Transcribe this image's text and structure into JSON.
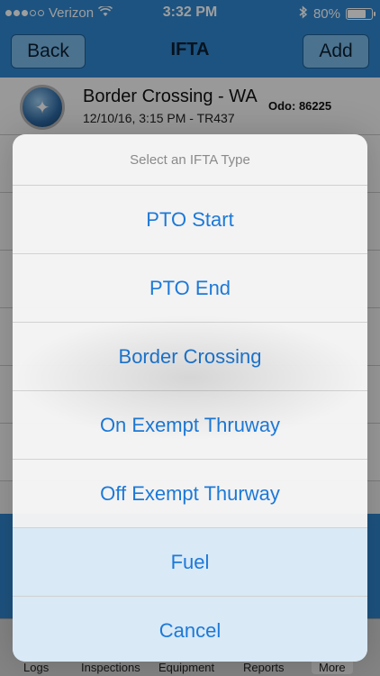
{
  "status_bar": {
    "carrier": "Verizon",
    "time": "3:32 PM",
    "battery_percent": "80%",
    "battery_level": 0.8,
    "signal_bars_filled": 3,
    "signal_bars_total": 5
  },
  "nav": {
    "back_label": "Back",
    "title": "IFTA",
    "add_label": "Add"
  },
  "list": {
    "rows": [
      {
        "title": "Border Crossing - WA",
        "subtitle": "12/10/16, 3:15 PM - TR437",
        "odo_label": "Odo:",
        "odo_value": "86225"
      }
    ]
  },
  "action_sheet": {
    "header": "Select an IFTA Type",
    "options": [
      "PTO Start",
      "PTO End",
      "Border Crossing",
      "On Exempt Thruway",
      "Off Exempt Thurway",
      "Fuel"
    ],
    "cancel_label": "Cancel"
  },
  "tab_bar": {
    "tabs": [
      "Logs",
      "Inspections",
      "Equipment",
      "Reports",
      "More"
    ]
  },
  "colors": {
    "brand_blue": "#2f86cf",
    "action_blue": "#1c79d8"
  }
}
